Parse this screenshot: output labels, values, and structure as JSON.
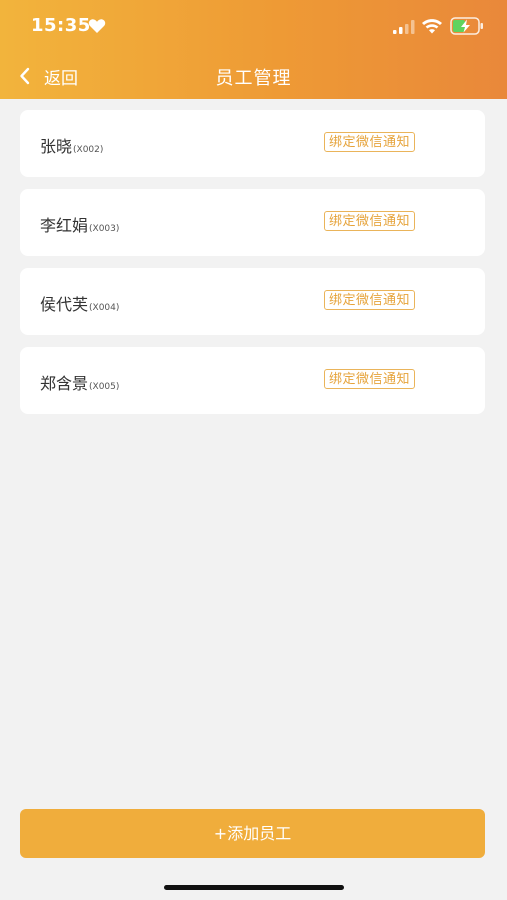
{
  "status_bar": {
    "time": "15:35"
  },
  "nav": {
    "back_label": "返回",
    "title": "员工管理"
  },
  "employees": [
    {
      "name": "张晓",
      "code": "(X002)",
      "bind_label": "绑定微信通知"
    },
    {
      "name": "李红娟",
      "code": "(X003)",
      "bind_label": "绑定微信通知"
    },
    {
      "name": "侯代芙",
      "code": "(X004)",
      "bind_label": "绑定微信通知"
    },
    {
      "name": "郑含景",
      "code": "(X005)",
      "bind_label": "绑定微信通知"
    }
  ],
  "footer": {
    "add_label": "+添加员工"
  },
  "colors": {
    "header_start": "#f2b43c",
    "header_end": "#e9883a",
    "accent": "#f0ad3c",
    "bind_border": "#eab45a",
    "background": "#f2f2f2"
  },
  "icons": {
    "heart": "heart-icon",
    "signal": "cellular-signal-icon",
    "wifi": "wifi-icon",
    "battery": "battery-charging-icon",
    "back": "chevron-left-icon"
  }
}
